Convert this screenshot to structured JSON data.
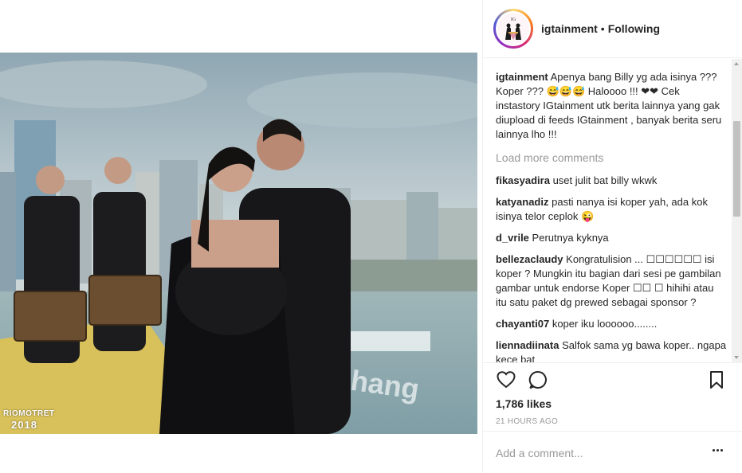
{
  "post": {
    "username": "igtainment",
    "separator": "•",
    "follow_status": "Following",
    "watermark_line1": "RIOMOTRET",
    "watermark_line2": "2018"
  },
  "caption": {
    "username": "igtainment",
    "text": "Apenya bang Billy yg ada isinya ??? Koper ??? 😅😅😅 Haloooo !!! ❤❤ Cek instastory IGtainment utk berita lainnya yang gak diupload di feeds IGtainment , banyak berita seru lainnya lho !!!"
  },
  "load_more": "Load more comments",
  "comments": [
    {
      "username": "fikasyadira",
      "text": "uset julit bat billy wkwk"
    },
    {
      "username": "katyanadiz",
      "text": "pasti nanya isi koper yah, ada kok isinya telor ceplok 😜"
    },
    {
      "username": "d_vrile",
      "text": "Perutnya kyknya"
    },
    {
      "username": "bellezaclaudy",
      "text": "Kongratulision ... ☐☐☐☐☐☐ isi koper ? Mungkin itu bagian dari sesi pe gambilan gambar untuk endorse Koper ☐☐ ☐ hihihi atau itu satu paket dg prewed sebagai sponsor ?"
    },
    {
      "username": "chayanti07",
      "text": "koper iku loooooo........"
    },
    {
      "username": "liennadiinata",
      "text": "Salfok sama yg bawa koper.. ngapa kece bat"
    }
  ],
  "actions": {
    "like_icon": "heart-icon",
    "comment_icon": "comment-icon",
    "save_icon": "bookmark-icon",
    "likes": "1,786 likes",
    "time": "21 HOURS AGO"
  },
  "add_comment": {
    "placeholder": "Add a comment...",
    "more_icon": "more-options-icon"
  }
}
